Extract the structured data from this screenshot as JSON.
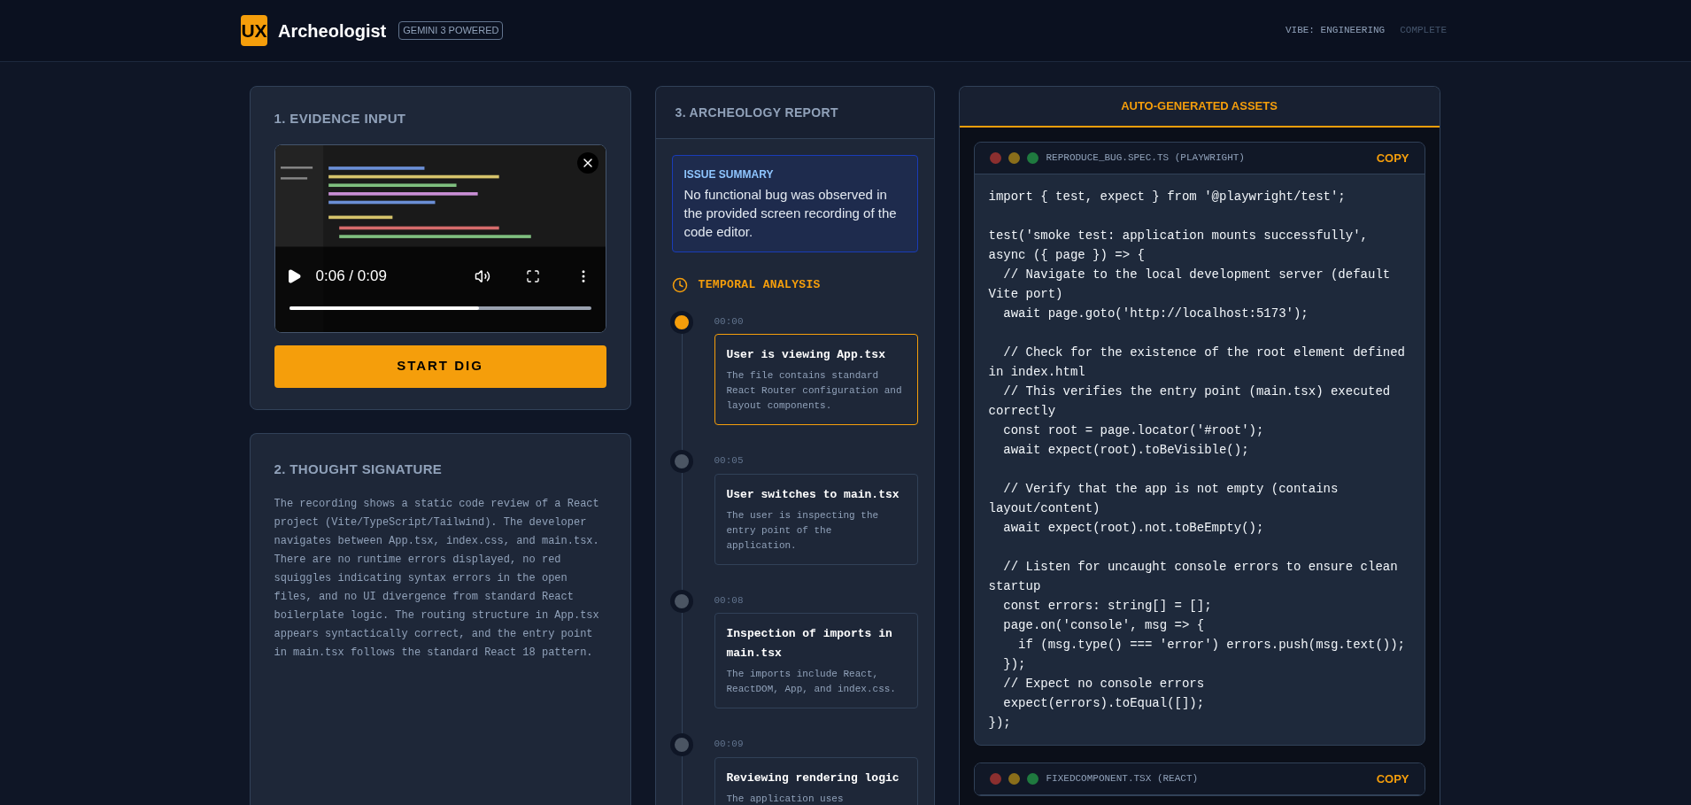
{
  "header": {
    "logo_mark": "UX",
    "title": "Archeologist",
    "badge": "GEMINI 3 POWERED",
    "vibe": "VIBE: ENGINEERING",
    "status": "COMPLETE"
  },
  "evidence": {
    "title": "1. EVIDENCE INPUT",
    "video": {
      "kind": "picture",
      "time": "0:06 / 0:09",
      "level": 0.63
    },
    "button": "START DIG"
  },
  "thought": {
    "title": "2. THOUGHT SIGNATURE",
    "text": "The recording shows a static code review of a React project (Vite/TypeScript/Tailwind). The developer navigates between App.tsx, index.css, and main.tsx. There are no runtime errors displayed, no red squiggles indicating syntax errors in the open files, and no UI divergence from standard React boilerplate logic. The routing structure in App.tsx appears syntactically correct, and the entry point in main.tsx follows the standard React 18 pattern."
  },
  "report": {
    "title": "3. ARCHEOLOGY REPORT",
    "summary": {
      "label": "ISSUE SUMMARY",
      "text": "No functional bug was observed in the provided screen recording of the code editor."
    },
    "temporal_title": "TEMPORAL ANALYSIS",
    "events": [
      {
        "time": "00:00",
        "title": "User is viewing App.tsx",
        "description": "The file contains standard React Router configuration and layout components.",
        "selected": true
      },
      {
        "time": "00:05",
        "title": "User switches to main.tsx",
        "description": "The user is inspecting the entry point of the application.",
        "selected": false
      },
      {
        "time": "00:08",
        "title": "Inspection of imports in main.tsx",
        "description": "The imports include React, ReactDOM, App, and index.css.",
        "selected": false
      },
      {
        "time": "00:09",
        "title": "Reviewing rendering logic",
        "description": "The application uses",
        "selected": false
      }
    ]
  },
  "assets": {
    "title": "AUTO-GENERATED ASSETS",
    "files": [
      {
        "name": "REPRODUCE_BUG.SPEC.TS (PLAYWRIGHT)",
        "copy": "COPY",
        "code": "import { test, expect } from '@playwright/test';\n\ntest('smoke test: application mounts successfully', async ({ page }) => {\n  // Navigate to the local development server (default Vite port)\n  await page.goto('http://localhost:5173');\n\n  // Check for the existence of the root element defined in index.html\n  // This verifies the entry point (main.tsx) executed correctly\n  const root = page.locator('#root');\n  await expect(root).toBeVisible();\n\n  // Verify that the app is not empty (contains layout/content)\n  await expect(root).not.toBeEmpty();\n\n  // Listen for uncaught console errors to ensure clean startup\n  const errors: string[] = [];\n  page.on('console', msg => {\n    if (msg.type() === 'error') errors.push(msg.text());\n  });\n  // Expect no console errors\n  expect(errors).toEqual([]);\n});"
      },
      {
        "name": "FIXEDCOMPONENT.TSX (REACT)",
        "copy": "COPY"
      }
    ]
  }
}
